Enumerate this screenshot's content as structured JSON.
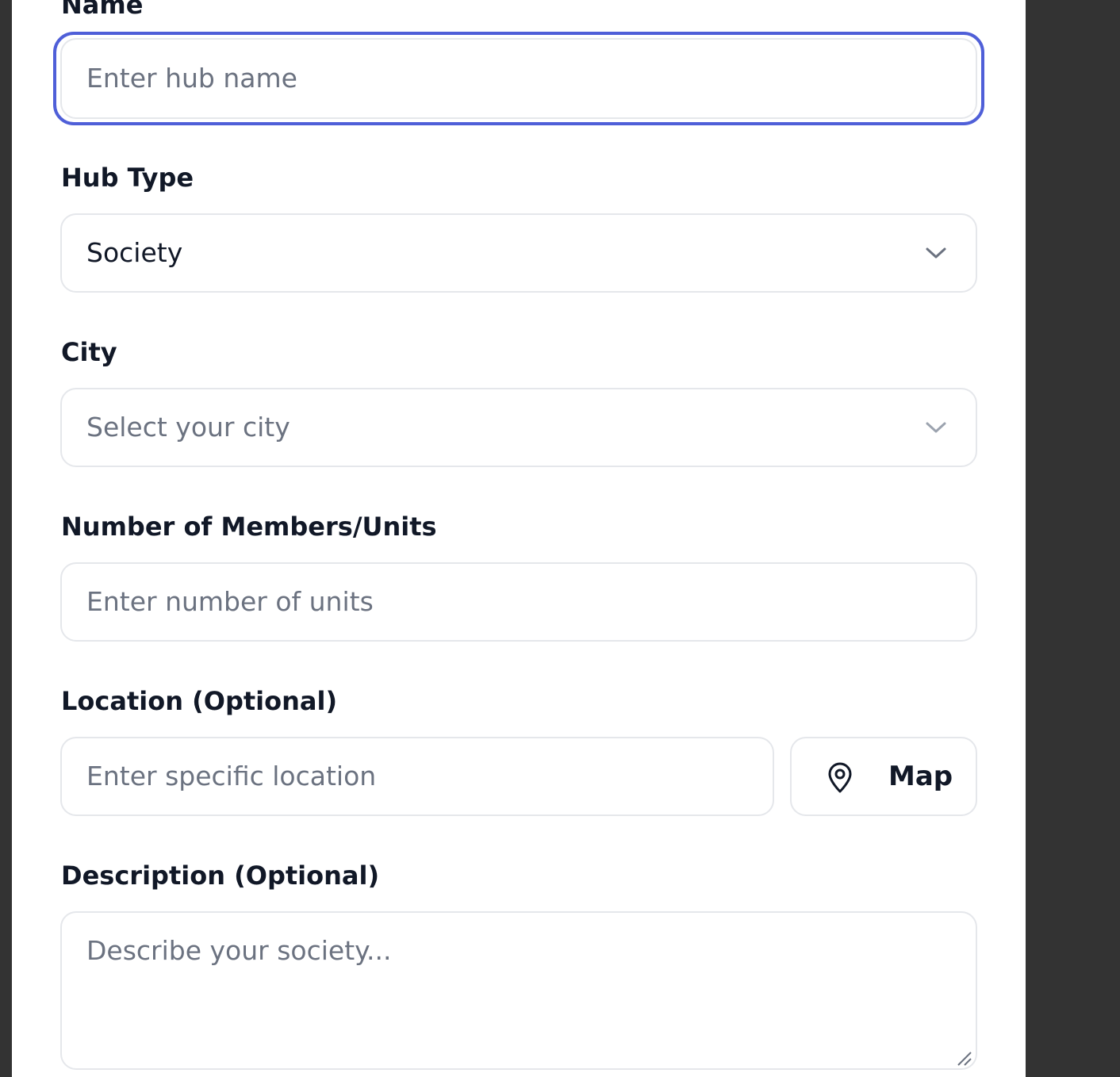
{
  "form": {
    "name": {
      "label": "Name",
      "placeholder": "Enter hub name"
    },
    "hub_type": {
      "label": "Hub Type",
      "selected": "Society"
    },
    "city": {
      "label": "City",
      "placeholder": "Select your city"
    },
    "members": {
      "label": "Number of Members/Units",
      "placeholder": "Enter number of units"
    },
    "location": {
      "label": "Location (Optional)",
      "placeholder": "Enter specific location",
      "map_button_label": "Map",
      "map_icon": "map-pin-icon"
    },
    "description": {
      "label": "Description (Optional)",
      "placeholder": "Describe your society..."
    }
  },
  "colors": {
    "focus_ring": "#4f5fd8",
    "border": "#e5e7eb",
    "label_text": "#111827",
    "placeholder_text": "#6b7280",
    "backdrop": "#333333"
  },
  "icons": {
    "select_chevron": "chevron-down-icon",
    "textarea_resize": "resize-handle-icon"
  }
}
